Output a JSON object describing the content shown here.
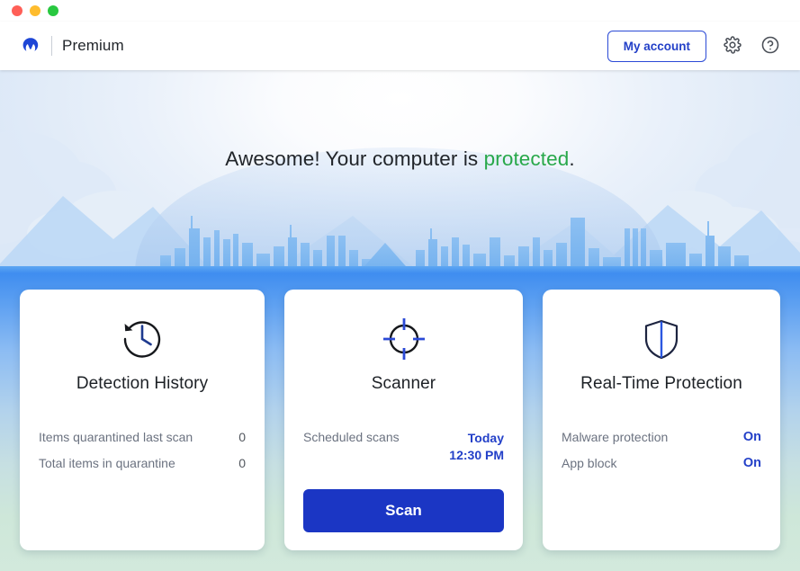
{
  "window": {
    "controls": [
      {
        "name": "close",
        "color": "#ff5f57"
      },
      {
        "name": "minimize",
        "color": "#febc2e"
      },
      {
        "name": "zoom",
        "color": "#28c840"
      }
    ]
  },
  "header": {
    "brand_name": "Premium",
    "logo_icon": "malwarebytes-logo-icon",
    "account_label": "My account",
    "settings_icon": "gear-icon",
    "help_icon": "help-circle-icon",
    "accent_color": "#2340c8"
  },
  "hero": {
    "message_prefix": "Awesome! Your computer is ",
    "status_word": "protected",
    "message_suffix": ".",
    "status_color": "#28a84a"
  },
  "cards": {
    "detection": {
      "icon": "clock-history-icon",
      "title": "Detection History",
      "rows": [
        {
          "label": "Items quarantined last scan",
          "value": "0"
        },
        {
          "label": "Total items in quarantine",
          "value": "0"
        }
      ]
    },
    "scanner": {
      "icon": "crosshair-target-icon",
      "title": "Scanner",
      "rows": [
        {
          "label": "Scheduled scans",
          "value_line1": "Today",
          "value_line2": "12:30 PM"
        }
      ],
      "button_label": "Scan"
    },
    "realtime": {
      "icon": "shield-icon",
      "title": "Real-Time Protection",
      "rows": [
        {
          "label": "Malware protection",
          "value": "On"
        },
        {
          "label": "App block",
          "value": "On"
        }
      ]
    }
  }
}
